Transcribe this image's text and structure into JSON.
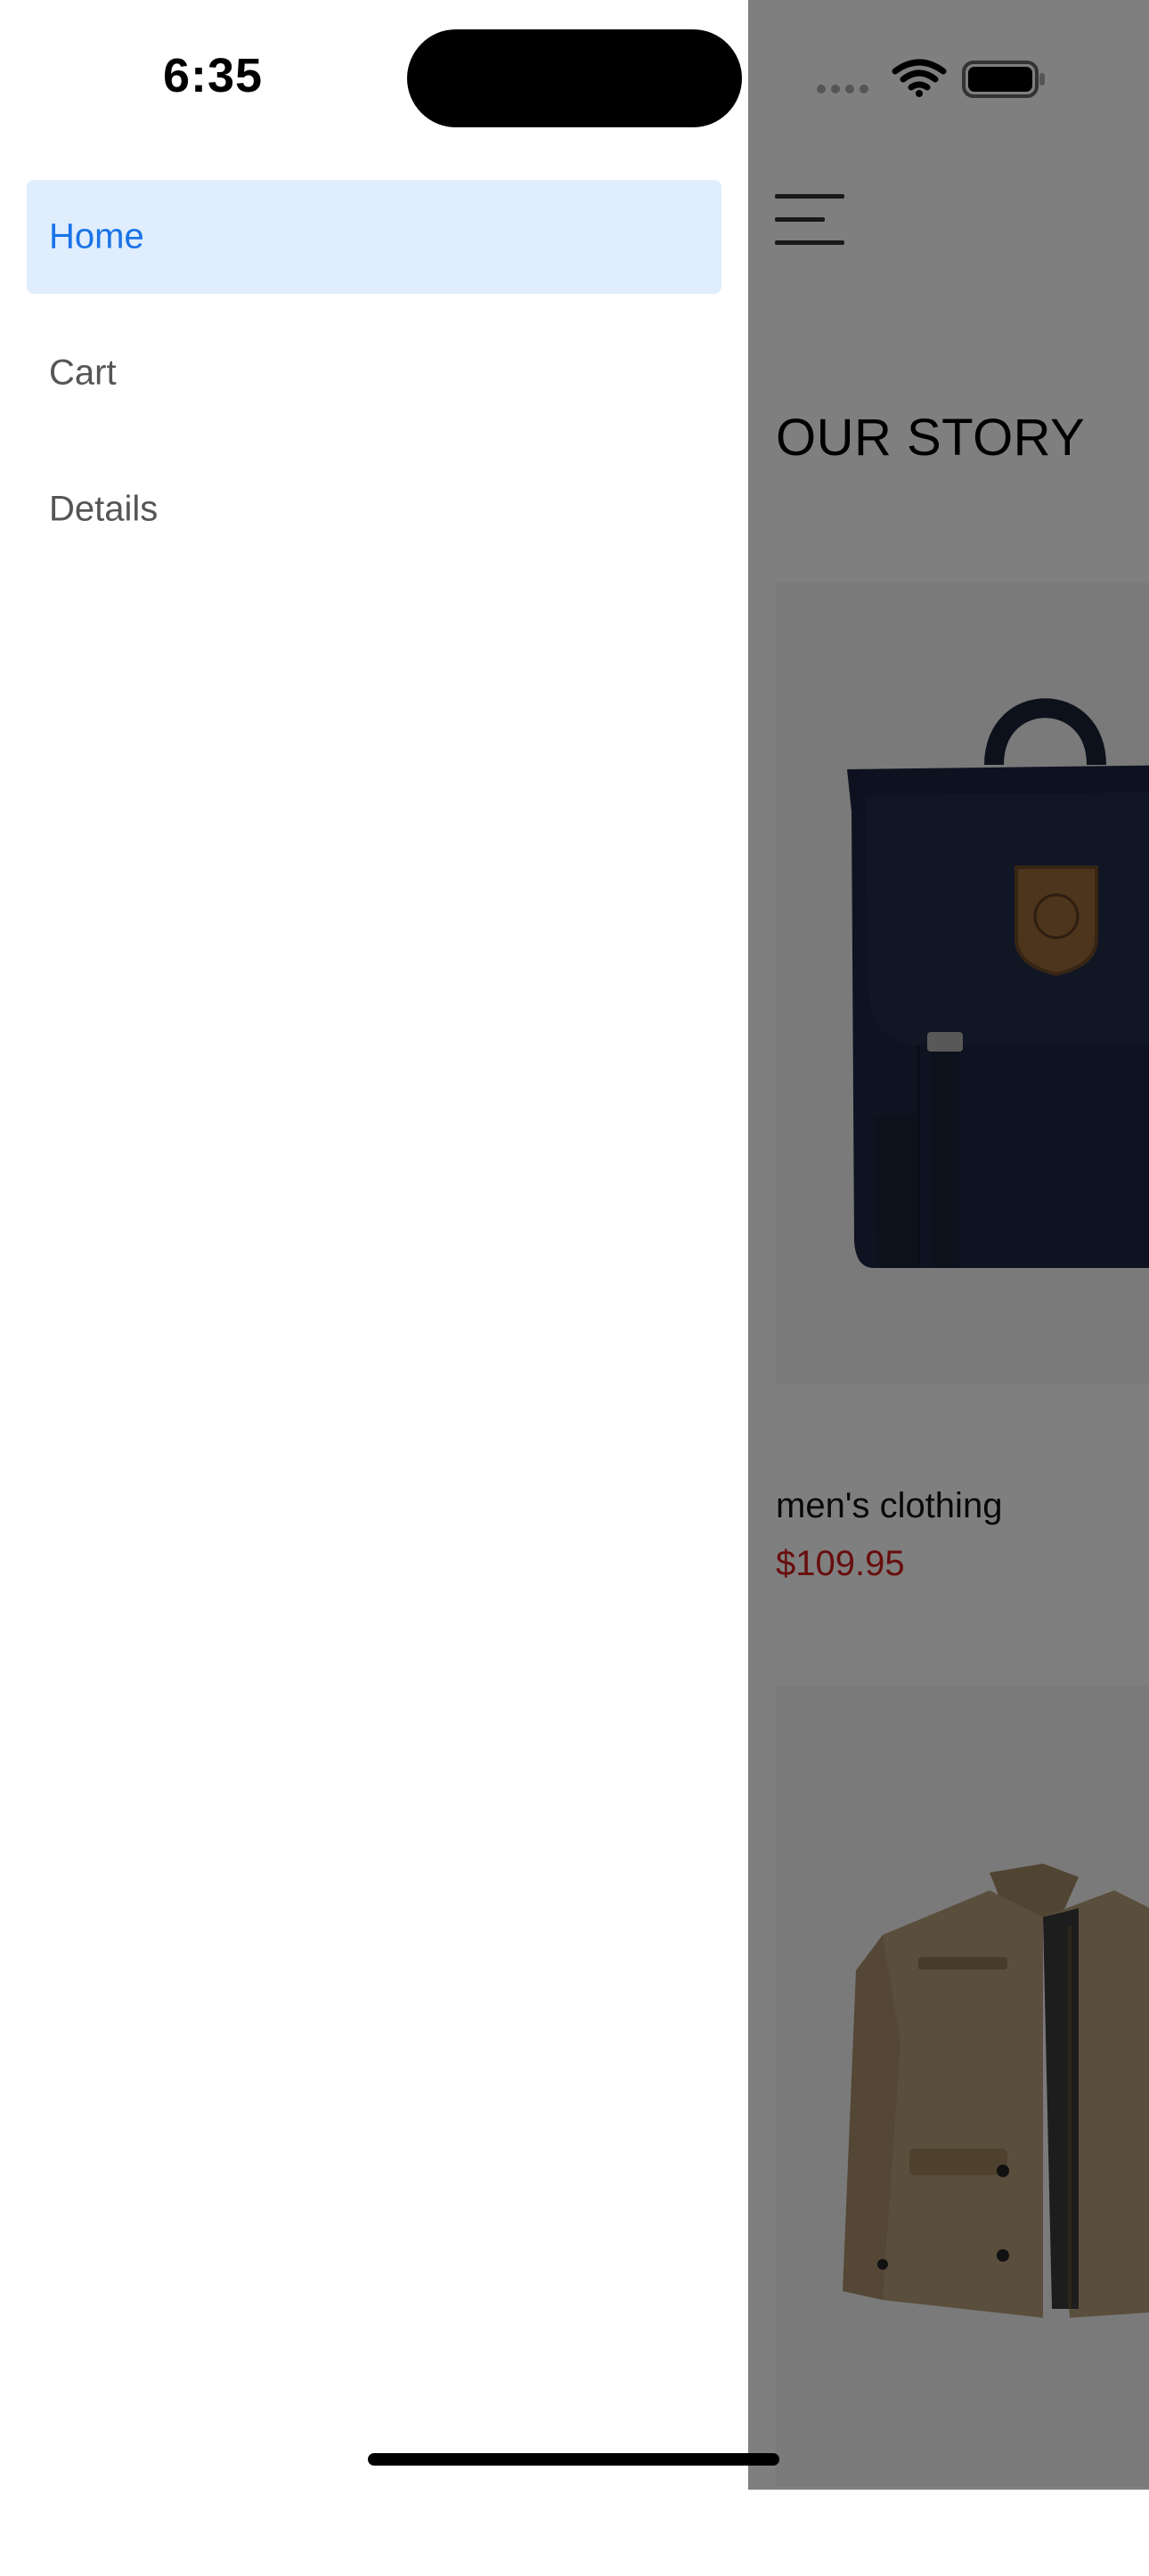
{
  "status_bar": {
    "time": "6:35"
  },
  "drawer": {
    "items": [
      {
        "label": "Home",
        "active": true
      },
      {
        "label": "Cart",
        "active": false
      },
      {
        "label": "Details",
        "active": false
      }
    ]
  },
  "main": {
    "menu_icon": "hamburger-menu-icon",
    "section_title": "OUR STORY",
    "products": [
      {
        "category": "men's clothing",
        "price": "$109.95",
        "image": "backpack"
      },
      {
        "category": "",
        "price": "",
        "image": "jacket"
      }
    ]
  },
  "colors": {
    "accent": "#1a73e8",
    "active_item_bg": "#dfedfd",
    "price": "#d11a1a",
    "scrim": "rgba(0,0,0,0.5)"
  }
}
